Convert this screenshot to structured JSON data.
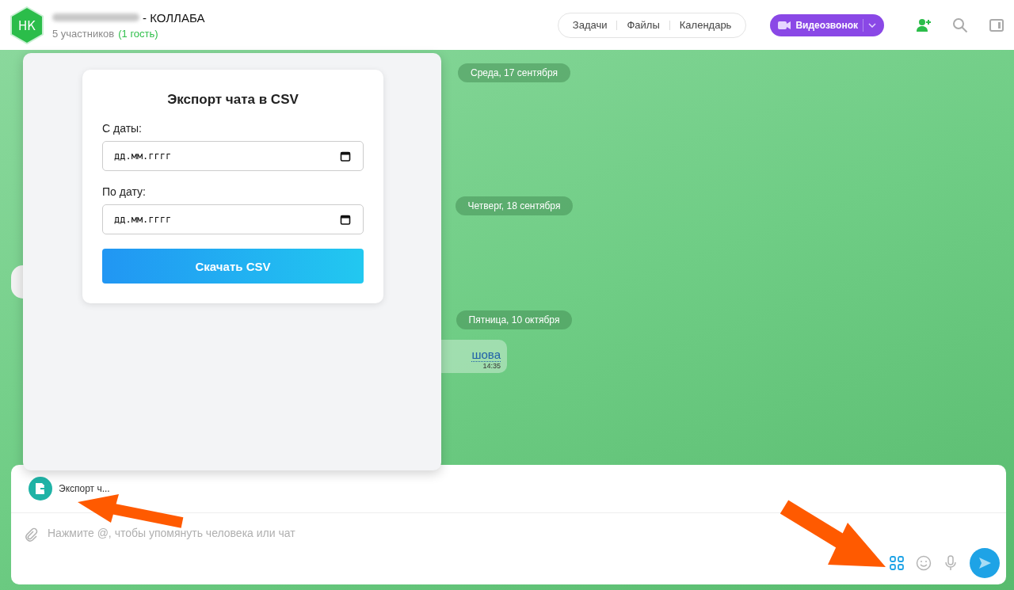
{
  "header": {
    "avatar_initials": "НК",
    "title": "- КОЛЛАБА",
    "participants": "5 участников",
    "guests": "(1 гость)"
  },
  "toolbar": {
    "links": [
      "Задачи",
      "Файлы",
      "Календарь"
    ],
    "call_button": "Видеозвонок"
  },
  "chat": {
    "dates": [
      "Среда, 17 сентября",
      "Четверг, 18 сентября",
      "Пятница, 10 октября"
    ],
    "message": {
      "text": "шова",
      "time": "14:35"
    }
  },
  "export_dialog": {
    "title": "Экспорт чата в CSV",
    "fields": [
      {
        "label": "С даты:",
        "placeholder": "дд.мм.гггг"
      },
      {
        "label": "По дату:",
        "placeholder": "дд.мм.гггг"
      }
    ],
    "button": "Скачать CSV"
  },
  "composer": {
    "attachment": "Экспорт ч...",
    "placeholder": "Нажмите @, чтобы упомянуть человека или чат"
  }
}
